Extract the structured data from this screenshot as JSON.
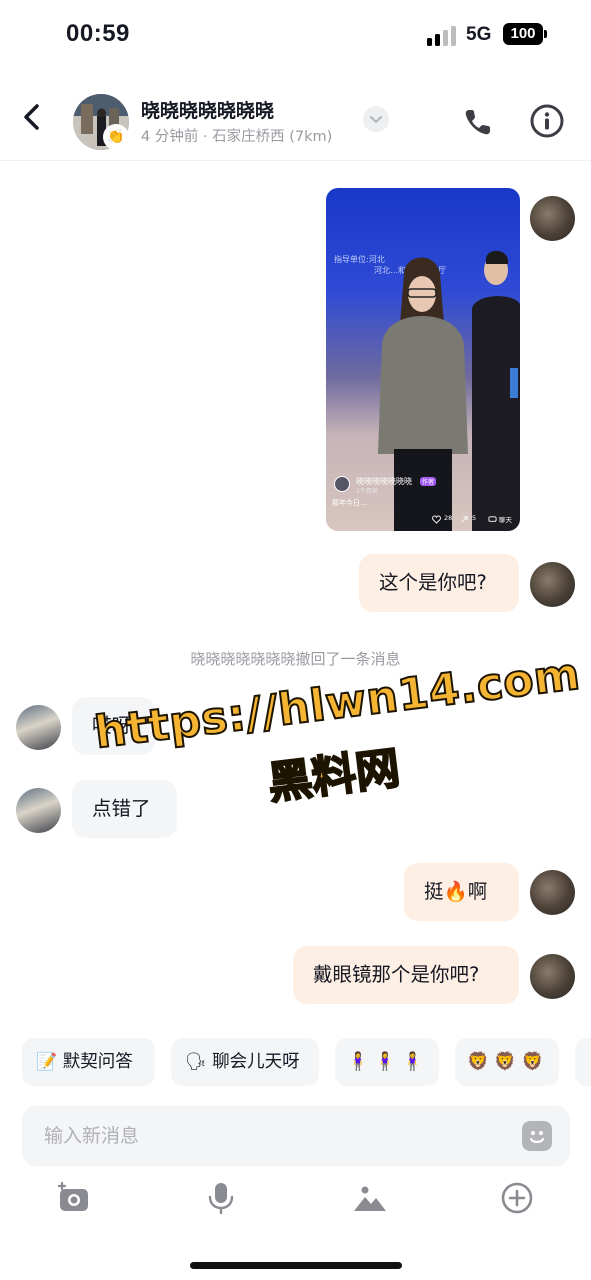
{
  "status_bar": {
    "time": "00:59",
    "network": "5G",
    "battery": "100"
  },
  "header": {
    "name": "晓晓晓晓晓晓晓",
    "status": "4 分钟前 · 石家庄桥西 (7km)",
    "avatar_badge": "👏"
  },
  "messages": {
    "shared_video": {
      "author": "晓晓晓晓晓晓晓",
      "author_tag": "作者",
      "time_ago": "2个月前",
      "caption": "那年今日...",
      "likes": "28",
      "shares": "5",
      "chat_label": "聊天",
      "stage_text": "指导单位:河北",
      "stage_text_2": "河北…和社会保障厅"
    },
    "m1": "这个是你吧?",
    "recall": "晓晓晓晓晓晓晓撤回了一条消息",
    "m2": "哎呀",
    "m3": "点错了",
    "m4_a": "挺",
    "m4_emoji": "🔥",
    "m4_b": "啊",
    "m5": "戴眼镜那个是你吧?"
  },
  "watermark": {
    "url": "https://hlwn14.com",
    "site": "黑料网"
  },
  "quick_replies": [
    {
      "icon": "📝",
      "label": "默契问答"
    },
    {
      "icon": "🗣",
      "label": "聊会儿天呀"
    },
    {
      "icon": "",
      "label": "🧍‍♀️ 🧍‍♀️ 🧍‍♀️"
    },
    {
      "icon": "",
      "label": "🦁 🦁 🦁"
    }
  ],
  "composer": {
    "placeholder": "输入新消息"
  },
  "colors": {
    "bubble_me": "#fdefe3",
    "bubble_them": "#f4f5f7",
    "watermark": "#f5b431"
  }
}
